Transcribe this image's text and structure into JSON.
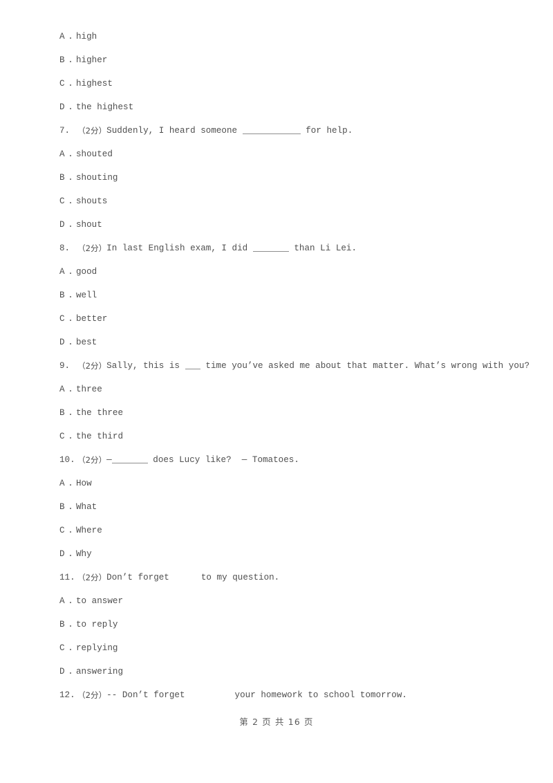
{
  "page": {
    "footer_text": "第 2 页 共 16 页",
    "page_number": "2",
    "total_pages": "16",
    "background_color": "#ffffff",
    "text_color": "#4f4f4f"
  },
  "questions": [
    {
      "number": "",
      "score": "",
      "stem_before": "",
      "blank": "none",
      "stem_after": "",
      "options": [
        {
          "letter": "A",
          "dot": ".",
          "text": "high"
        },
        {
          "letter": "B",
          "dot": ".",
          "text": "higher"
        },
        {
          "letter": "C",
          "dot": ".",
          "text": "highest"
        },
        {
          "letter": "D",
          "dot": ".",
          "text": "the highest"
        }
      ]
    },
    {
      "number": "7.",
      "score": "（2分）",
      "stem_before": "Suddenly, I heard someone ",
      "blank": "long",
      "stem_after": " for help.",
      "options": [
        {
          "letter": "A",
          "dot": ".",
          "text": "shouted"
        },
        {
          "letter": "B",
          "dot": ".",
          "text": "shouting"
        },
        {
          "letter": "C",
          "dot": ".",
          "text": "shouts"
        },
        {
          "letter": "D",
          "dot": ".",
          "text": "shout"
        }
      ]
    },
    {
      "number": "8.",
      "score": "（2分）",
      "stem_before": "In last English exam, I did ",
      "blank": "med",
      "stem_after": " than Li Lei.",
      "options": [
        {
          "letter": "A",
          "dot": ".",
          "text": "good"
        },
        {
          "letter": "B",
          "dot": ".",
          "text": "well"
        },
        {
          "letter": "C",
          "dot": ".",
          "text": "better"
        },
        {
          "letter": "D",
          "dot": ".",
          "text": "best"
        }
      ]
    },
    {
      "number": "9.",
      "score": "（2分）",
      "stem_before": "Sally, this is ",
      "blank": "short",
      "stem_after": " time you’ve asked me about that matter. What’s wrong with you?",
      "options": [
        {
          "letter": "A",
          "dot": ".",
          "text": "three"
        },
        {
          "letter": "B",
          "dot": ".",
          "text": "the three"
        },
        {
          "letter": "C",
          "dot": ".",
          "text": "the third"
        }
      ]
    },
    {
      "number": "10.",
      "score": "（2分）",
      "stem_before": "—",
      "blank": "med",
      "stem_after": " does Lucy like?  — Tomatoes.",
      "options": [
        {
          "letter": "A",
          "dot": ".",
          "text": "How"
        },
        {
          "letter": "B",
          "dot": ".",
          "text": "What"
        },
        {
          "letter": "C",
          "dot": ".",
          "text": "Where"
        },
        {
          "letter": "D",
          "dot": ".",
          "text": "Why"
        }
      ]
    },
    {
      "number": "11.",
      "score": "（2分）",
      "stem_before": "Don’t forget",
      "blank": "gap1",
      "stem_after": "to my question.",
      "options": [
        {
          "letter": "A",
          "dot": ".",
          "text": "to answer"
        },
        {
          "letter": "B",
          "dot": ".",
          "text": "to reply"
        },
        {
          "letter": "C",
          "dot": ".",
          "text": "replying"
        },
        {
          "letter": "D",
          "dot": ".",
          "text": "answering"
        }
      ]
    },
    {
      "number": "12.",
      "score": "（2分）",
      "stem_before": "-- Don’t forget",
      "blank": "gap2",
      "stem_after": "your homework to school tomorrow.",
      "options": []
    }
  ]
}
